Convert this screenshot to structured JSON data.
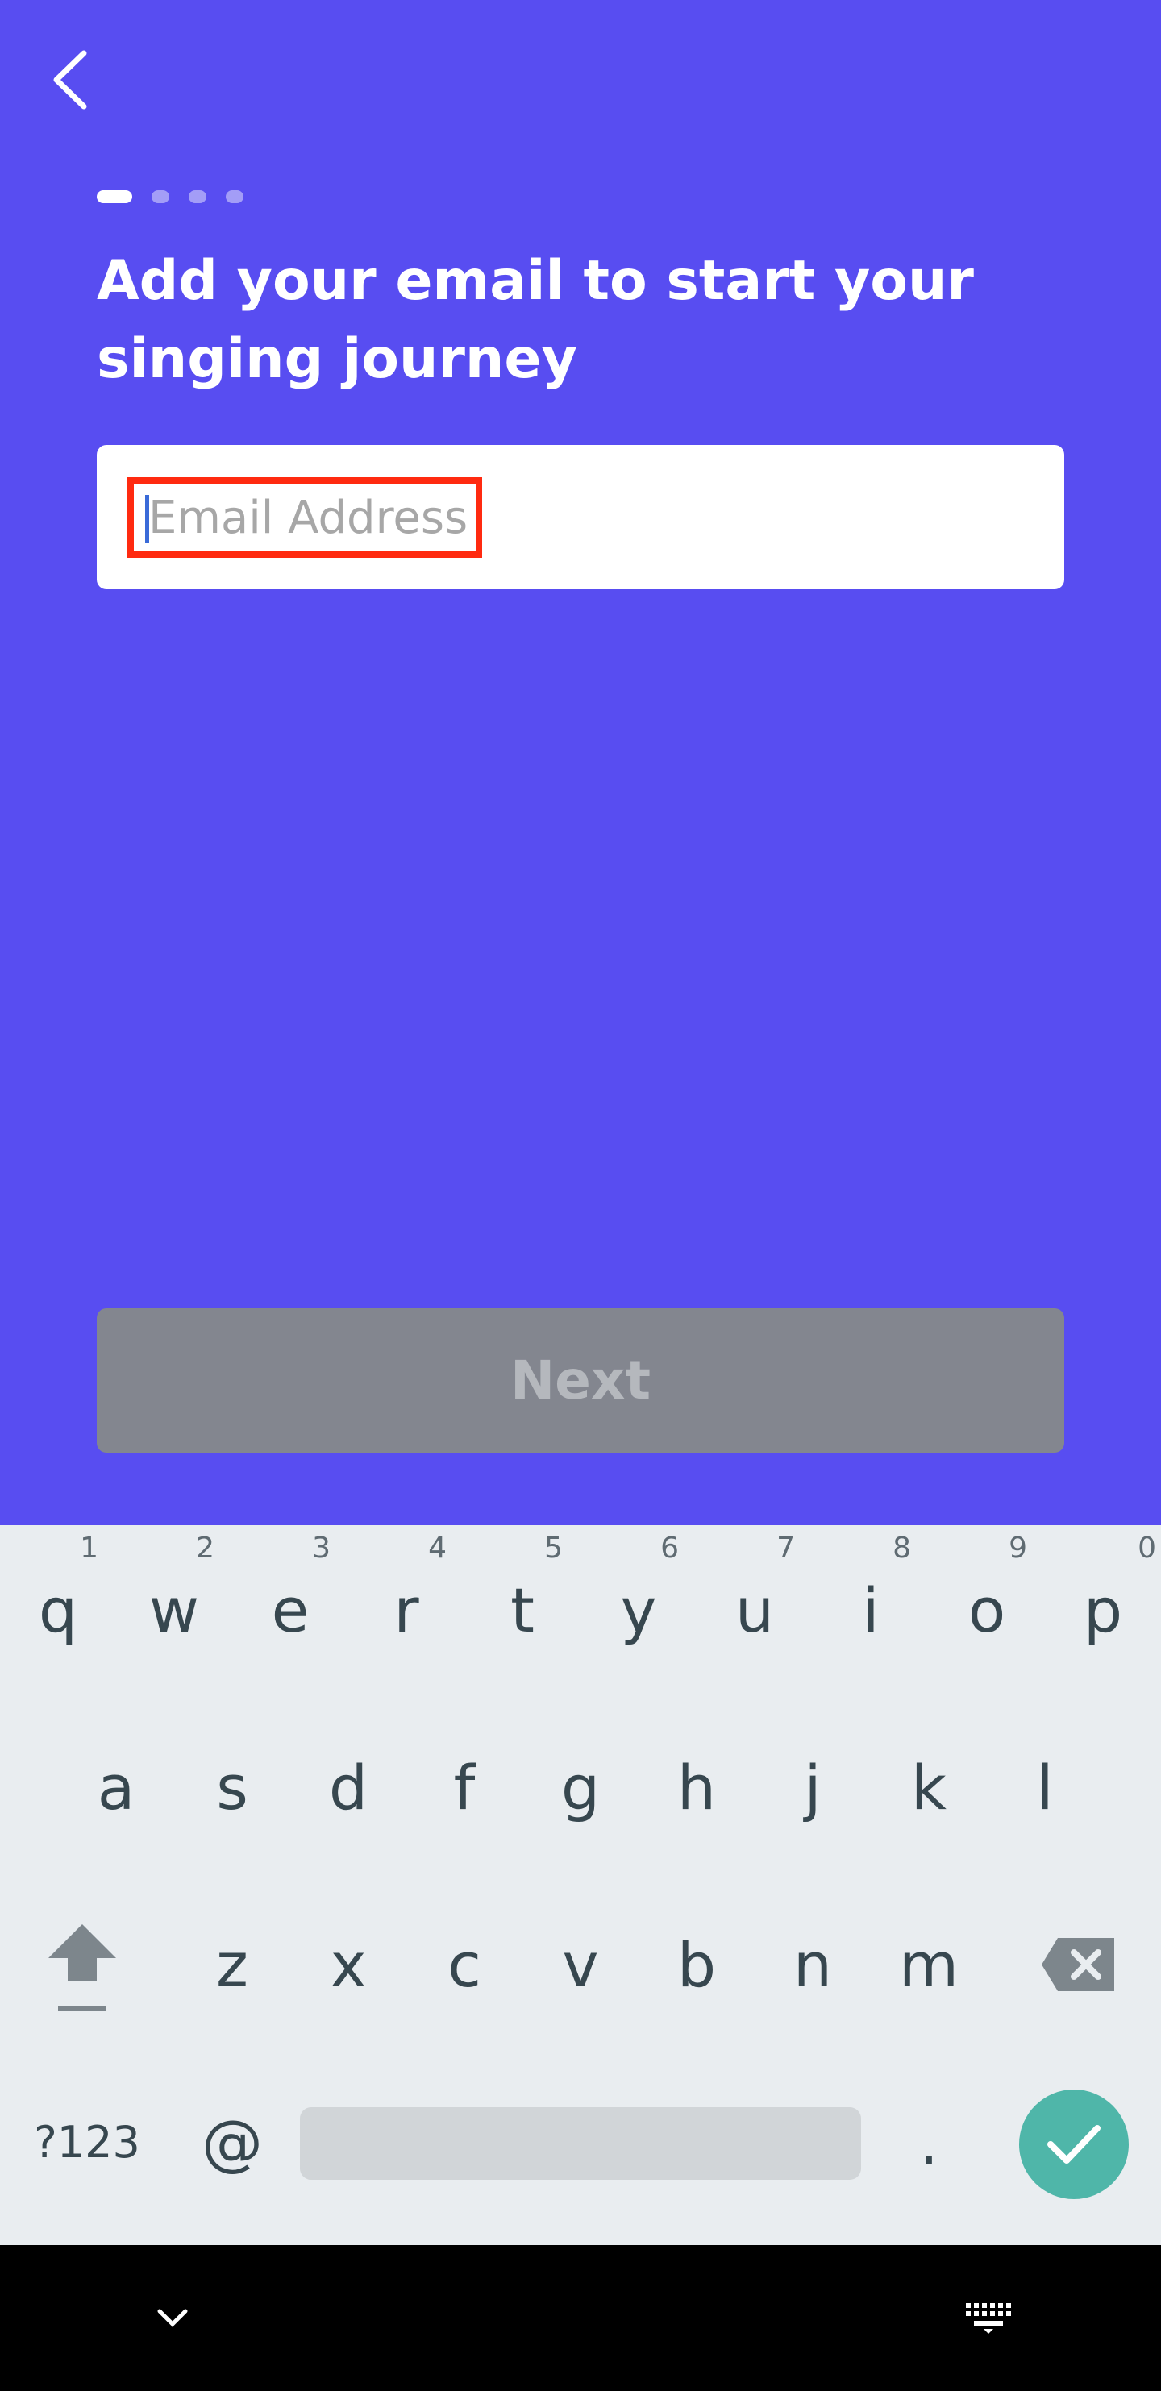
{
  "screen": {
    "title": "Add your email to start your singing journey",
    "progress": {
      "total_steps": 4,
      "current_step": 1
    },
    "email": {
      "placeholder": "Email Address",
      "value": ""
    },
    "next_label": "Next"
  },
  "colors": {
    "background": "#584df1",
    "next_disabled_bg": "#83868f",
    "next_disabled_text": "#b5b8bd",
    "focus_outline": "#ff2a10",
    "keyboard_bg": "#e9edf0",
    "enter_key": "#4fb6a9"
  },
  "keyboard": {
    "row1": [
      {
        "letter": "q",
        "hint": "1"
      },
      {
        "letter": "w",
        "hint": "2"
      },
      {
        "letter": "e",
        "hint": "3"
      },
      {
        "letter": "r",
        "hint": "4"
      },
      {
        "letter": "t",
        "hint": "5"
      },
      {
        "letter": "y",
        "hint": "6"
      },
      {
        "letter": "u",
        "hint": "7"
      },
      {
        "letter": "i",
        "hint": "8"
      },
      {
        "letter": "o",
        "hint": "9"
      },
      {
        "letter": "p",
        "hint": "0"
      }
    ],
    "row2": [
      "a",
      "s",
      "d",
      "f",
      "g",
      "h",
      "j",
      "k",
      "l"
    ],
    "row3": [
      "z",
      "x",
      "c",
      "v",
      "b",
      "n",
      "m"
    ],
    "symbols_label": "?123",
    "at_label": "@",
    "period_label": ".",
    "icons": {
      "shift": "shift-arrow-icon",
      "backspace": "backspace-icon",
      "enter": "checkmark-icon"
    }
  },
  "navbar": {
    "icons": {
      "left": "chevron-down-icon",
      "right": "keyboard-icon"
    }
  }
}
